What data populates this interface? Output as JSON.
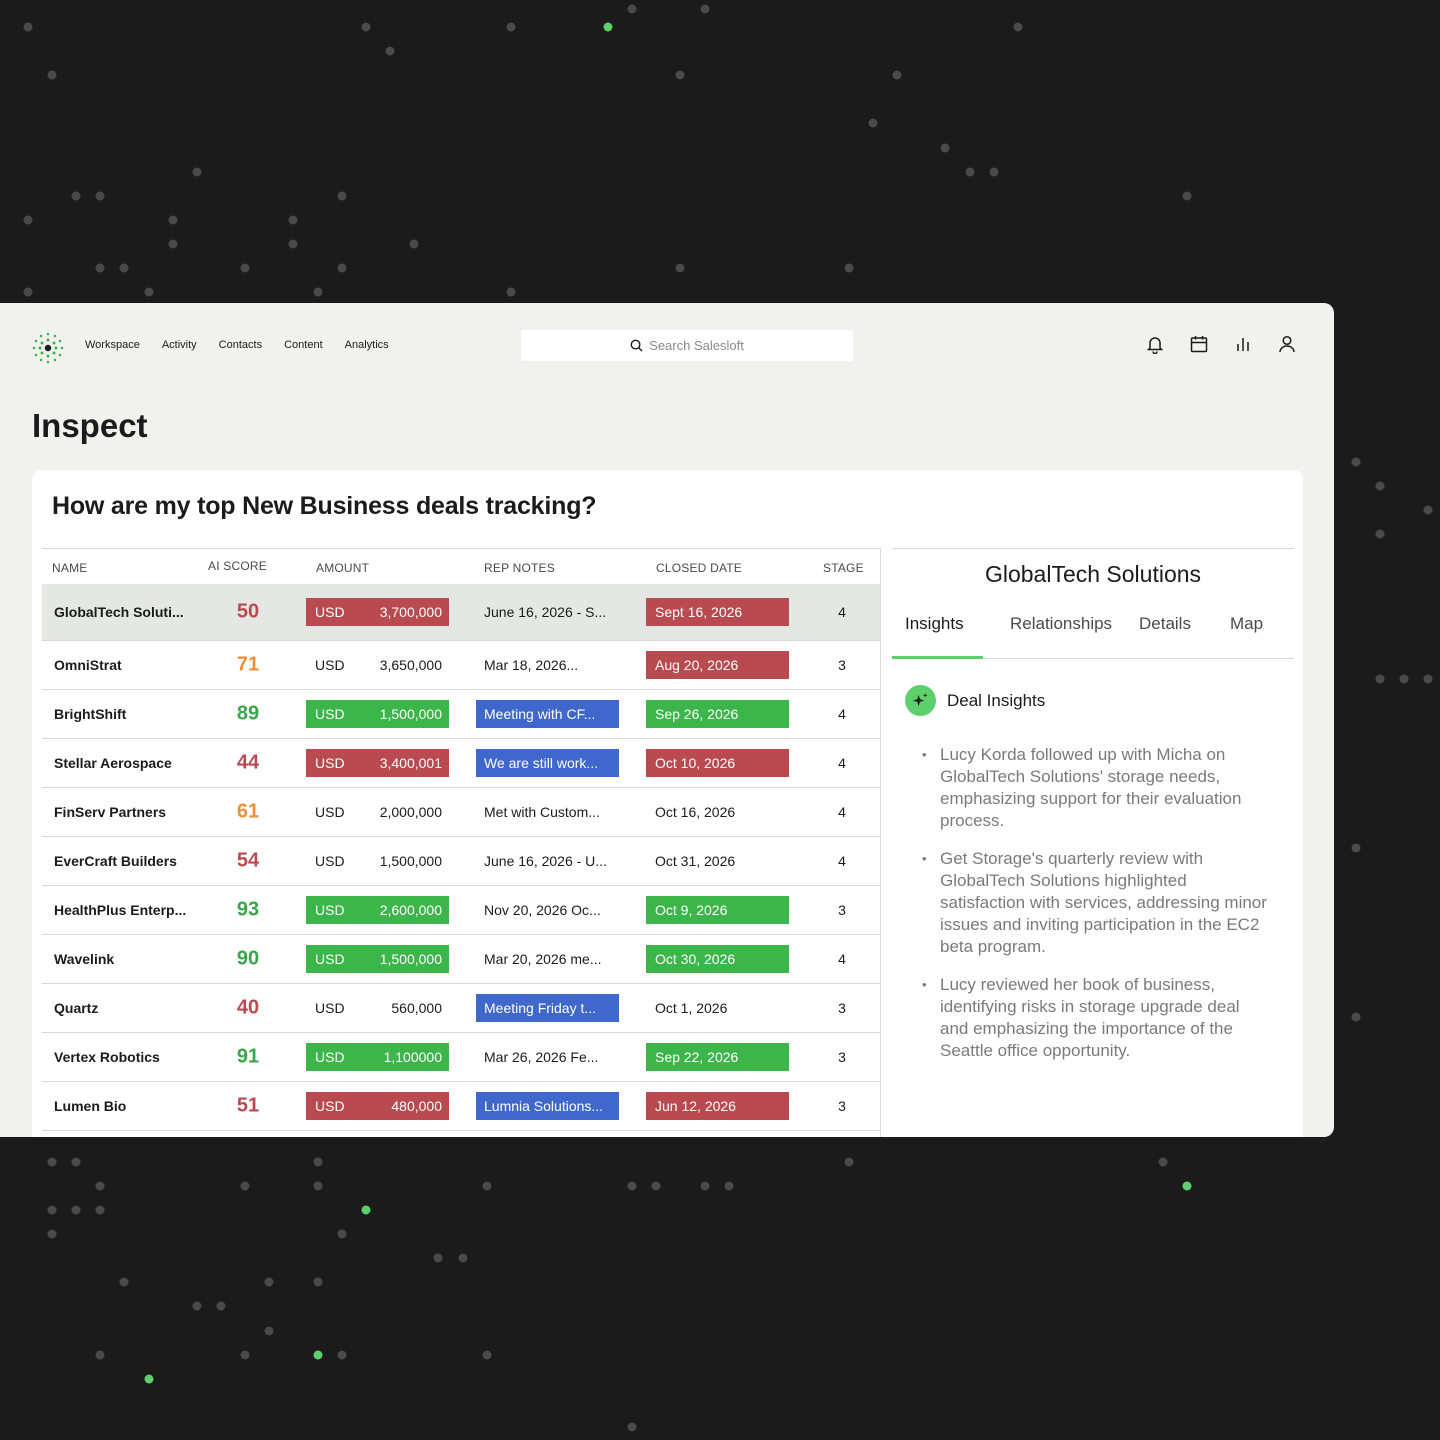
{
  "nav": {
    "items": [
      "Workspace",
      "Activity",
      "Contacts",
      "Content",
      "Analytics"
    ],
    "search_placeholder": "Search Salesloft"
  },
  "page": {
    "title": "Inspect",
    "question": "How are my top New Business deals tracking?"
  },
  "table": {
    "headers": {
      "name": "NAME",
      "score": "AI SCORE",
      "amount": "AMOUNT",
      "notes": "REP NOTES",
      "closed": "CLOSED DATE",
      "stage": "STAGE"
    },
    "rows": [
      {
        "name": "GlobalTech Soluti...",
        "score": "50",
        "score_color": "red",
        "currency": "USD",
        "amount": "3,700,000",
        "amount_status": "red",
        "notes": "June 16, 2026 - S...",
        "notes_status": "",
        "closed": "Sept 16, 2026",
        "closed_status": "red",
        "stage": "4"
      },
      {
        "name": "OmniStrat",
        "score": "71",
        "score_color": "orange",
        "currency": "USD",
        "amount": "3,650,000",
        "amount_status": "",
        "notes": "Mar 18, 2026...",
        "notes_status": "",
        "closed": "Aug 20, 2026",
        "closed_status": "red",
        "stage": "3"
      },
      {
        "name": "BrightShift",
        "score": "89",
        "score_color": "green",
        "currency": "USD",
        "amount": "1,500,000",
        "amount_status": "green",
        "notes": "Meeting with CF...",
        "notes_status": "blue",
        "closed": "Sep 26, 2026",
        "closed_status": "green",
        "stage": "4"
      },
      {
        "name": "Stellar Aerospace",
        "score": "44",
        "score_color": "red",
        "currency": "USD",
        "amount": "3,400,001",
        "amount_status": "red",
        "notes": "We are still work...",
        "notes_status": "blue",
        "closed": "Oct 10, 2026",
        "closed_status": "red",
        "stage": "4"
      },
      {
        "name": "FinServ Partners",
        "score": "61",
        "score_color": "orange",
        "currency": "USD",
        "amount": "2,000,000",
        "amount_status": "",
        "notes": "Met with Custom...",
        "notes_status": "",
        "closed": "Oct 16, 2026",
        "closed_status": "",
        "stage": "4"
      },
      {
        "name": "EverCraft Builders",
        "score": "54",
        "score_color": "red",
        "currency": "USD",
        "amount": "1,500,000",
        "amount_status": "",
        "notes": "June 16, 2026 - U...",
        "notes_status": "",
        "closed": "Oct 31, 2026",
        "closed_status": "",
        "stage": "4"
      },
      {
        "name": "HealthPlus Enterp...",
        "score": "93",
        "score_color": "green",
        "currency": "USD",
        "amount": "2,600,000",
        "amount_status": "green",
        "notes": "Nov 20, 2026 Oc...",
        "notes_status": "",
        "closed": "Oct 9, 2026",
        "closed_status": "green",
        "stage": "3"
      },
      {
        "name": "Wavelink",
        "score": "90",
        "score_color": "green",
        "currency": "USD",
        "amount": "1,500,000",
        "amount_status": "green",
        "notes": "Mar 20, 2026 me...",
        "notes_status": "",
        "closed": "Oct 30, 2026",
        "closed_status": "green",
        "stage": "4"
      },
      {
        "name": "Quartz",
        "score": "40",
        "score_color": "red",
        "currency": "USD",
        "amount": "560,000",
        "amount_status": "",
        "notes": "Meeting Friday t...",
        "notes_status": "blue",
        "closed": "Oct 1, 2026",
        "closed_status": "",
        "stage": "3"
      },
      {
        "name": "Vertex Robotics",
        "score": "91",
        "score_color": "green",
        "currency": "USD",
        "amount": "1,100000",
        "amount_status": "green",
        "notes": "Mar 26, 2026 Fe...",
        "notes_status": "",
        "closed": "Sep 22, 2026",
        "closed_status": "green",
        "stage": "3"
      },
      {
        "name": "Lumen Bio",
        "score": "51",
        "score_color": "red",
        "currency": "USD",
        "amount": "480,000",
        "amount_status": "red",
        "notes": "Lumnia Solutions...",
        "notes_status": "blue",
        "closed": "Jun 12, 2026",
        "closed_status": "red",
        "stage": "3"
      }
    ]
  },
  "panel": {
    "company": "GlobalTech Solutions",
    "tabs": [
      "Insights",
      "Relationships",
      "Details",
      "Map"
    ],
    "active_tab": "Insights",
    "insights_title": "Deal Insights",
    "insights": [
      "Lucy Korda followed up with Micha on GlobalTech Solutions' storage needs, emphasizing support for their evaluation process.",
      "Get Storage's quarterly review with GlobalTech Solutions highlighted satisfaction with services, addressing minor issues and inviting participation in the EC2 beta program.",
      "Lucy reviewed her book of business, identifying risks in storage upgrade deal and emphasizing the importance of the Seattle office opportunity."
    ]
  },
  "colors": {
    "accent_green": "#5ed06b",
    "status_red": "#b94a50",
    "status_green": "#3cb54a",
    "status_blue": "#3f67cc",
    "score_red": "#b94a50",
    "score_orange": "#e8913a",
    "score_green": "#3aa64a"
  },
  "icons": {
    "top": [
      "bell-icon",
      "calendar-icon",
      "bar-chart-icon",
      "user-icon"
    ],
    "search": "search-icon",
    "insights": "sparkle-icon"
  }
}
